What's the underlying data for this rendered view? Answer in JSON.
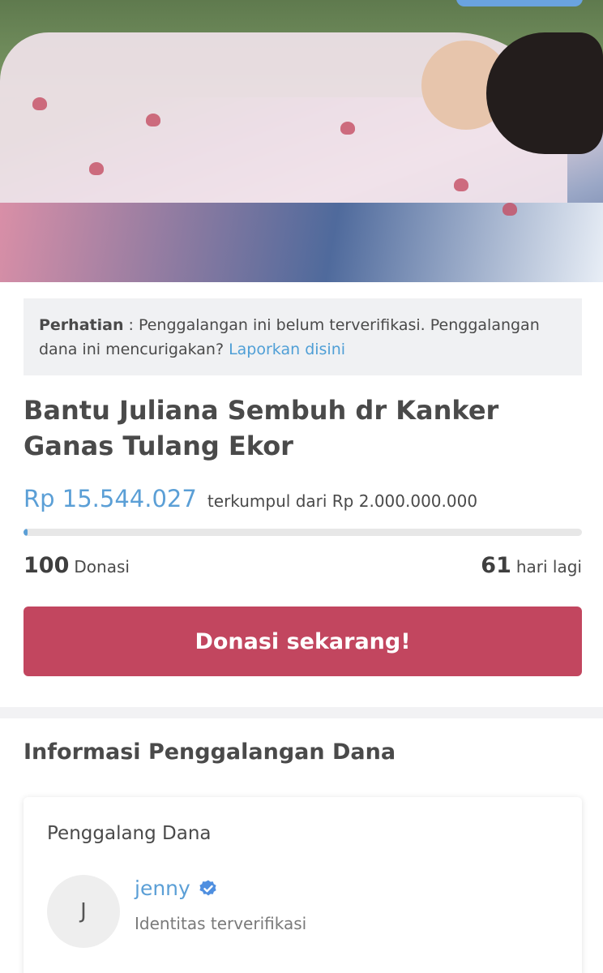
{
  "notice": {
    "label": "Perhatian",
    "text": " : Penggalangan ini belum terverifikasi. Penggalangan dana ini mencurigakan? ",
    "link": "Laporkan disini"
  },
  "campaign": {
    "title": "Bantu Juliana Sembuh dr Kanker Ganas Tulang Ekor",
    "amount": "Rp 15.544.027",
    "amount_sub": "terkumpul dari Rp 2.000.000.000",
    "progress_fraction": 0.0078,
    "donations_count": "100",
    "donations_label": "Donasi",
    "days_count": "61",
    "days_label": "hari lagi",
    "donate_label": "Donasi sekarang!"
  },
  "info": {
    "section_title": "Informasi Penggalangan Dana",
    "card_title": "Penggalang Dana",
    "avatar_initial": "J",
    "organizer_name": "jenny",
    "organizer_status": "Identitas terverifikasi"
  },
  "colors": {
    "accent_blue": "#5b9fd6",
    "donate_red": "#c2465f"
  },
  "icons": {
    "verified": "verified-check-icon"
  }
}
